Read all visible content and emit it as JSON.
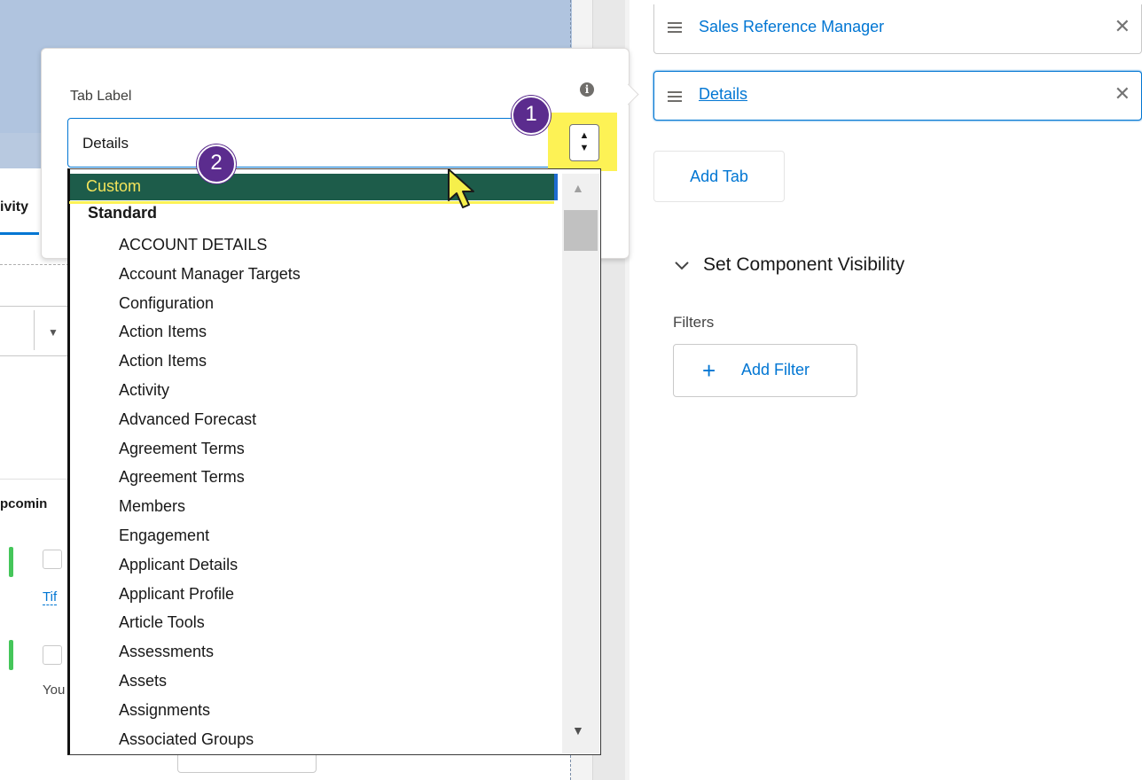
{
  "popover": {
    "label": "Tab Label",
    "selected_value": "Details",
    "badges": [
      "1",
      "2"
    ]
  },
  "dropdown": {
    "highlighted_option": "Custom",
    "group_label": "Standard",
    "options": [
      "ACCOUNT DETAILS",
      "Account Manager Targets",
      "Configuration",
      "Action Items",
      "Action Items",
      "Activity",
      "Advanced Forecast",
      "Agreement Terms",
      "Agreement Terms",
      "Members",
      "Engagement",
      "Applicant Details",
      "Applicant Profile",
      "Article Tools",
      "Assessments",
      "Assets",
      "Assignments",
      "Associated Groups"
    ]
  },
  "background": {
    "activity_tab": "ivity",
    "upcoming_label": "pcomin",
    "link_text": "Tif",
    "you_text": "You"
  },
  "tabs_panel": {
    "tabs": [
      {
        "name": "Sales Reference Manager"
      },
      {
        "name": "Details"
      }
    ],
    "add_tab_label": "Add Tab"
  },
  "visibility": {
    "title": "Set Component Visibility",
    "filters_label": "Filters",
    "add_filter_label": "Add Filter"
  },
  "icons": {
    "info": "info-icon",
    "drag": "drag-handle-icon",
    "close": "close-icon",
    "chevron": "chevron-down-icon",
    "plus": "plus-icon",
    "cursor": "mouse-pointer-icon"
  },
  "colors": {
    "accent": "#0176d3",
    "highlight": "#fdf255",
    "badge": "#5b2c8e",
    "selected_option_bg": "#1d5c4a"
  }
}
